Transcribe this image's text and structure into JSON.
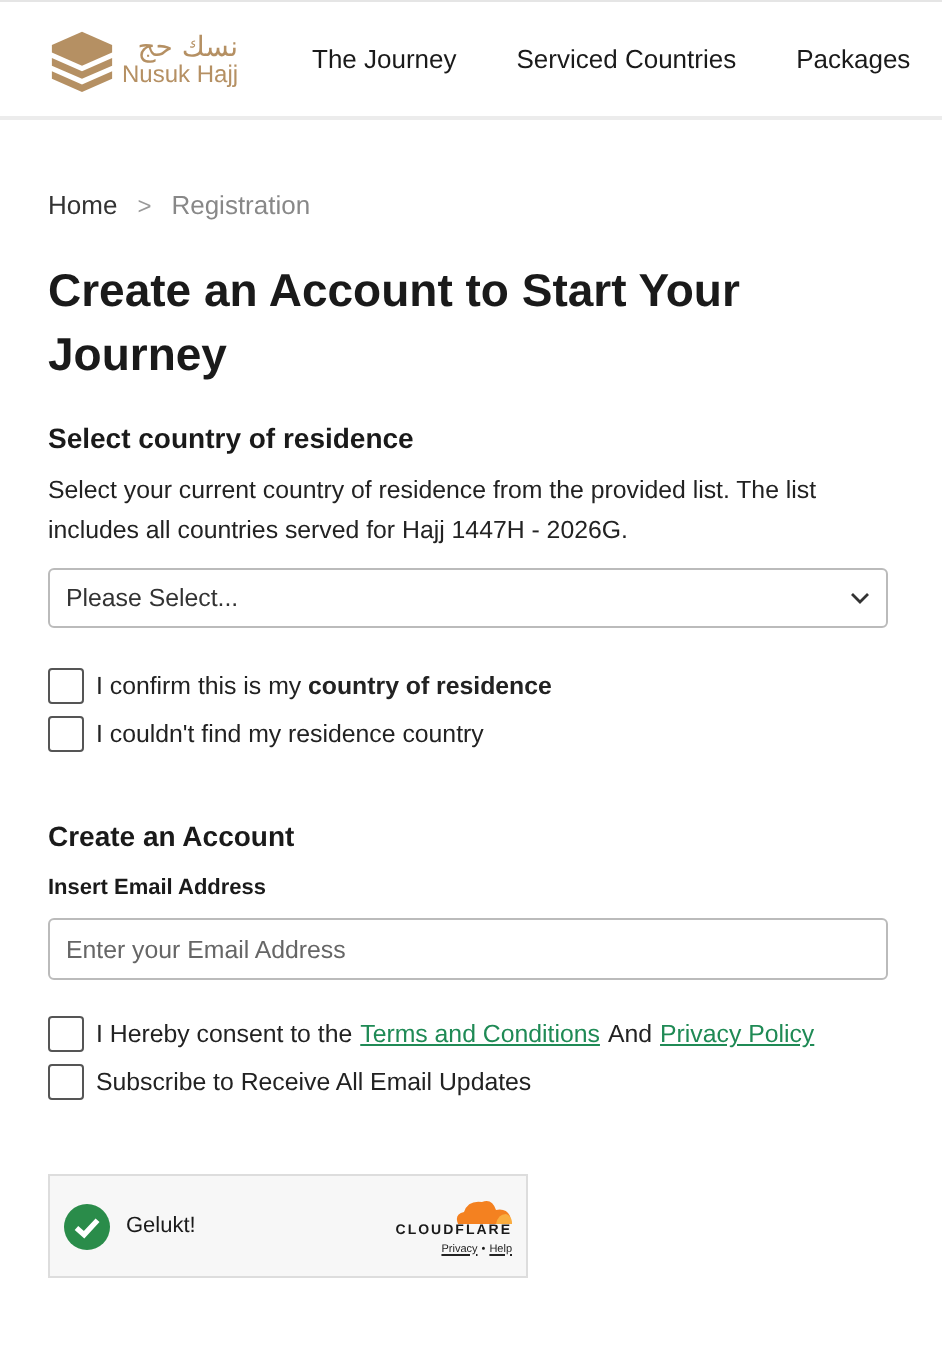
{
  "header": {
    "logo_arabic": "نسك حج",
    "logo_text": "Nusuk Hajj",
    "nav": [
      "The Journey",
      "Serviced Countries",
      "Packages"
    ]
  },
  "breadcrumb": [
    {
      "label": "Home",
      "current": false
    },
    {
      "label": "Registration",
      "current": true
    }
  ],
  "breadcrumb_separator": ">",
  "title": "Create an Account to Start Your Journey",
  "country_section": {
    "heading": "Select country of residence",
    "description": "Select your current country of residence from the provided list. The list includes all countries served for Hajj 1447H - 2026G.",
    "select": {
      "placeholder": "Please Select..."
    },
    "checkboxes": [
      {
        "label": "I confirm this is my **country of residence**",
        "checked": false
      },
      {
        "label": "I couldn't find my residence country",
        "checked": false
      }
    ]
  },
  "account_section": {
    "heading": "Create an Account",
    "email_label": "Insert Email Address",
    "email": {
      "placeholder": "Enter your Email Address"
    },
    "consent": {
      "checked": false,
      "parts": [
        {
          "kind": "text",
          "text": "I Hereby consent to the"
        },
        {
          "kind": "link",
          "text": "Terms and Conditions"
        },
        {
          "kind": "text",
          "text": "And"
        },
        {
          "kind": "link",
          "text": "Privacy Policy"
        }
      ]
    },
    "subscribe": {
      "label": "Subscribe to Receive All Email Updates",
      "checked": false
    }
  },
  "captcha": {
    "status": "Gelukt!",
    "success": true,
    "brand": "CLOUDFLARE",
    "links": [
      "Privacy",
      "Help"
    ],
    "link_separator": "•"
  }
}
